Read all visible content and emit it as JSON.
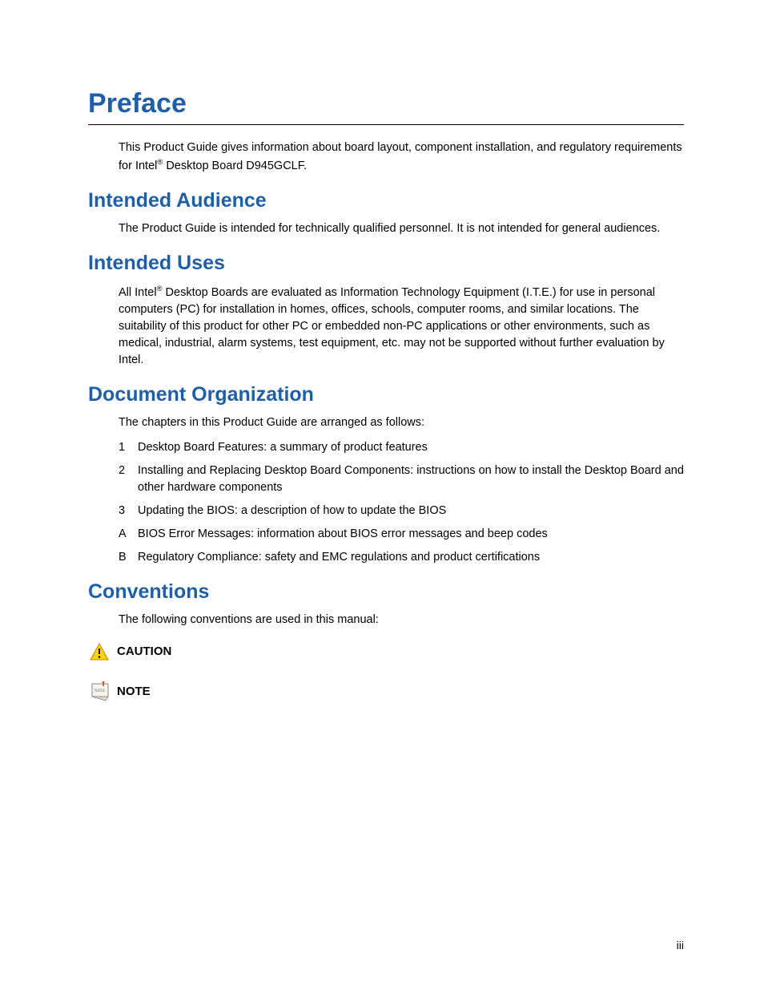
{
  "title": "Preface",
  "intro_html": "This Product Guide gives information about board layout, component installation, and regulatory requirements for Intel<sup>®</sup> Desktop Board D945GCLF.",
  "sections": {
    "audience": {
      "heading": "Intended Audience",
      "body": "The Product Guide is intended for technically qualified personnel.  It is not intended for general audiences."
    },
    "uses": {
      "heading": "Intended Uses",
      "body_html": "All Intel<sup>®</sup> Desktop Boards are evaluated as Information Technology Equipment (I.T.E.) for use in personal computers (PC) for installation in homes, offices, schools, computer rooms, and similar locations.  The suitability of this product for other PC or embedded non-PC applications or other environments, such as medical, industrial, alarm systems, test equipment, etc. may not be supported without further evaluation by Intel."
    },
    "organization": {
      "heading": "Document Organization",
      "intro": "The chapters in this Product Guide are arranged as follows:",
      "items": [
        {
          "marker": "1",
          "text": "Desktop Board Features:  a summary of product features"
        },
        {
          "marker": "2",
          "text": "Installing and Replacing Desktop Board Components:  instructions on how to install the Desktop Board and other hardware components"
        },
        {
          "marker": "3",
          "text": "Updating the BIOS:  a description of how to update the BIOS"
        },
        {
          "marker": "A",
          "text": "BIOS Error Messages:  information about BIOS error messages and beep codes"
        },
        {
          "marker": "B",
          "text": "Regulatory Compliance:  safety and EMC regulations and product certifications"
        }
      ]
    },
    "conventions": {
      "heading": "Conventions",
      "intro": "The following conventions are used in this manual:",
      "caution_label": "CAUTION",
      "note_label": "NOTE"
    }
  },
  "page_number": "iii"
}
